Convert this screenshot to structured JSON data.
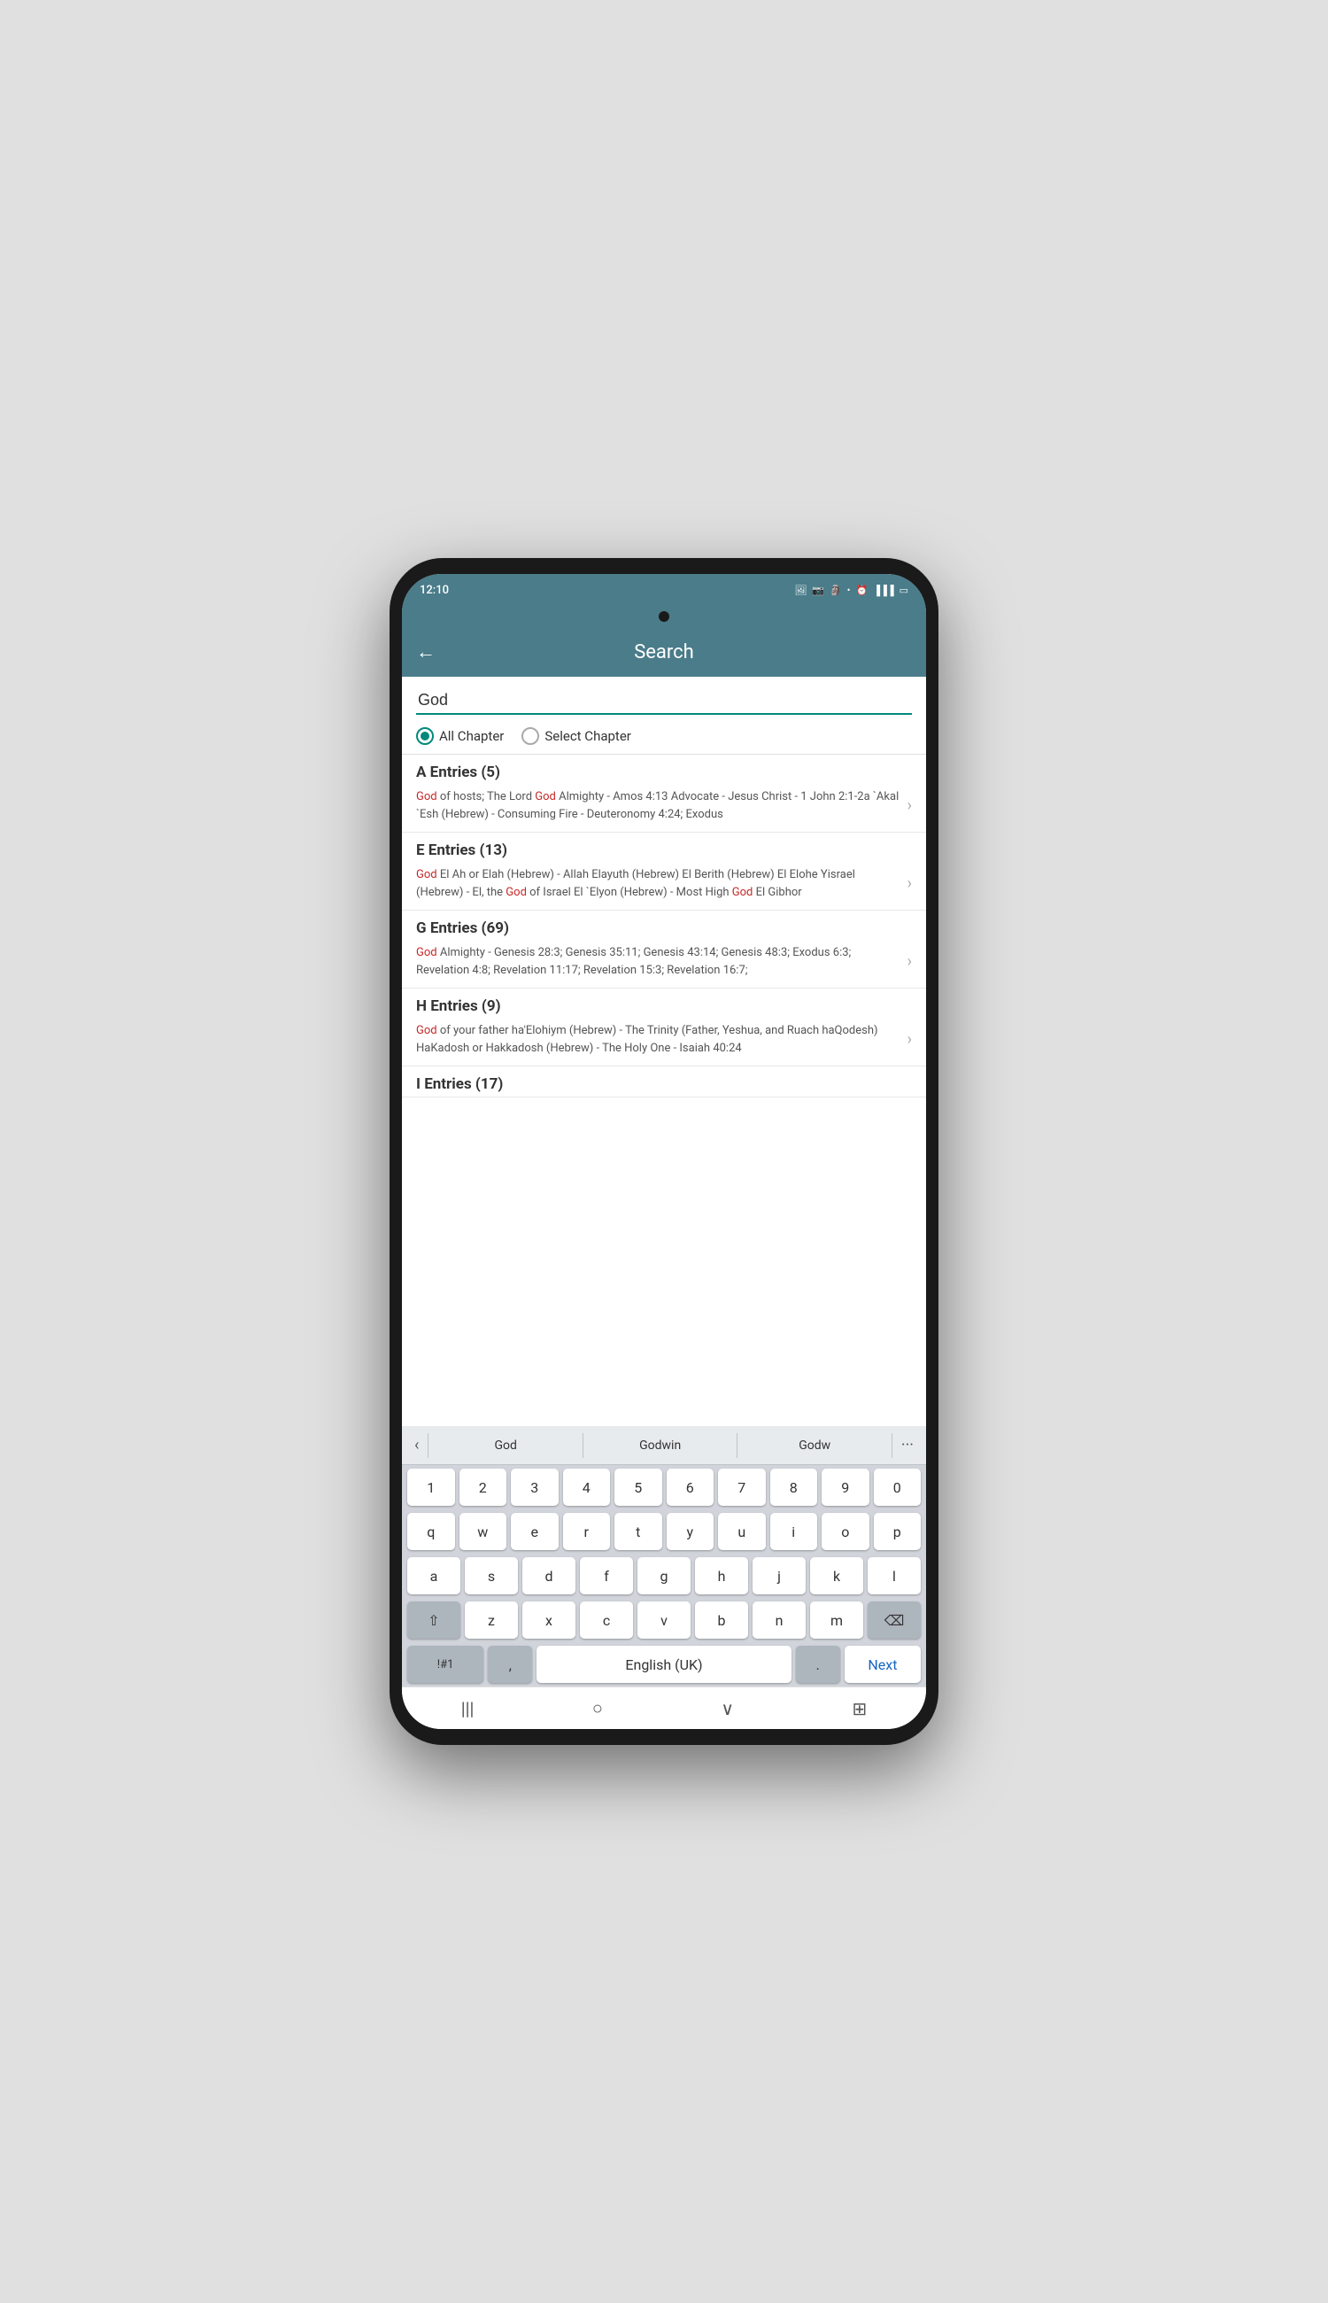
{
  "statusBar": {
    "time": "12:10",
    "icons": [
      "🖼",
      "📷",
      "🔔",
      "•"
    ]
  },
  "header": {
    "title": "Search",
    "backLabel": "←"
  },
  "searchInput": {
    "value": "God",
    "placeholder": ""
  },
  "radioGroup": {
    "options": [
      {
        "id": "all",
        "label": "All Chapter",
        "checked": true
      },
      {
        "id": "select",
        "label": "Select Chapter",
        "checked": false
      }
    ]
  },
  "entries": [
    {
      "header": "A Entries (5)",
      "text": "God of hosts; The Lord God Almighty - Amos 4:13 Advocate - Jesus Christ - 1 John 2:1-2a `Akal `Esh (Hebrew) - Consuming Fire - Deuteronomy 4:24; Exodus",
      "highlights": [
        0,
        22
      ]
    },
    {
      "header": "E Entries (13)",
      "text": "God El Ah or Elah (Hebrew) - Allah Elayuth (Hebrew) El Berith (Hebrew) El Elohe Yisrael (Hebrew) - El, the God of Israel El `Elyon (Hebrew) - Most High God El Gibhor",
      "highlights": [
        0,
        107,
        151
      ]
    },
    {
      "header": "G Entries (69)",
      "text": "God Almighty - Genesis 28:3; Genesis 35:11; Genesis 43:14; Genesis 48:3; Exodus 6:3; Revelation 4:8; Revelation 11:17; Revelation 15:3; Revelation 16:7;",
      "highlights": [
        0
      ]
    },
    {
      "header": "H Entries (9)",
      "text": "God of your father ha'Elohiym (Hebrew) - The Trinity (Father, Yeshua, and Ruach haQodesh) HaKadosh or Hakkadosh (Hebrew) - The Holy One - Isaiah 40:24",
      "highlights": [
        0
      ]
    },
    {
      "header": "I Entries (17)",
      "text": ""
    }
  ],
  "keyboard": {
    "suggestions": [
      "‹",
      "God",
      "Godwin",
      "Godw",
      "···"
    ],
    "rows": [
      [
        "1",
        "2",
        "3",
        "4",
        "5",
        "6",
        "7",
        "8",
        "9",
        "0"
      ],
      [
        "q",
        "w",
        "e",
        "r",
        "t",
        "y",
        "u",
        "i",
        "o",
        "p"
      ],
      [
        "a",
        "s",
        "d",
        "f",
        "g",
        "h",
        "j",
        "k",
        "l"
      ],
      [
        "⇧",
        "z",
        "x",
        "c",
        "v",
        "b",
        "n",
        "m",
        "⌫"
      ],
      [
        "!#1",
        ",",
        "English (UK)",
        ".",
        "Next"
      ]
    ]
  },
  "bottomNav": {
    "items": [
      "|||",
      "○",
      "∨",
      "⊞"
    ]
  }
}
